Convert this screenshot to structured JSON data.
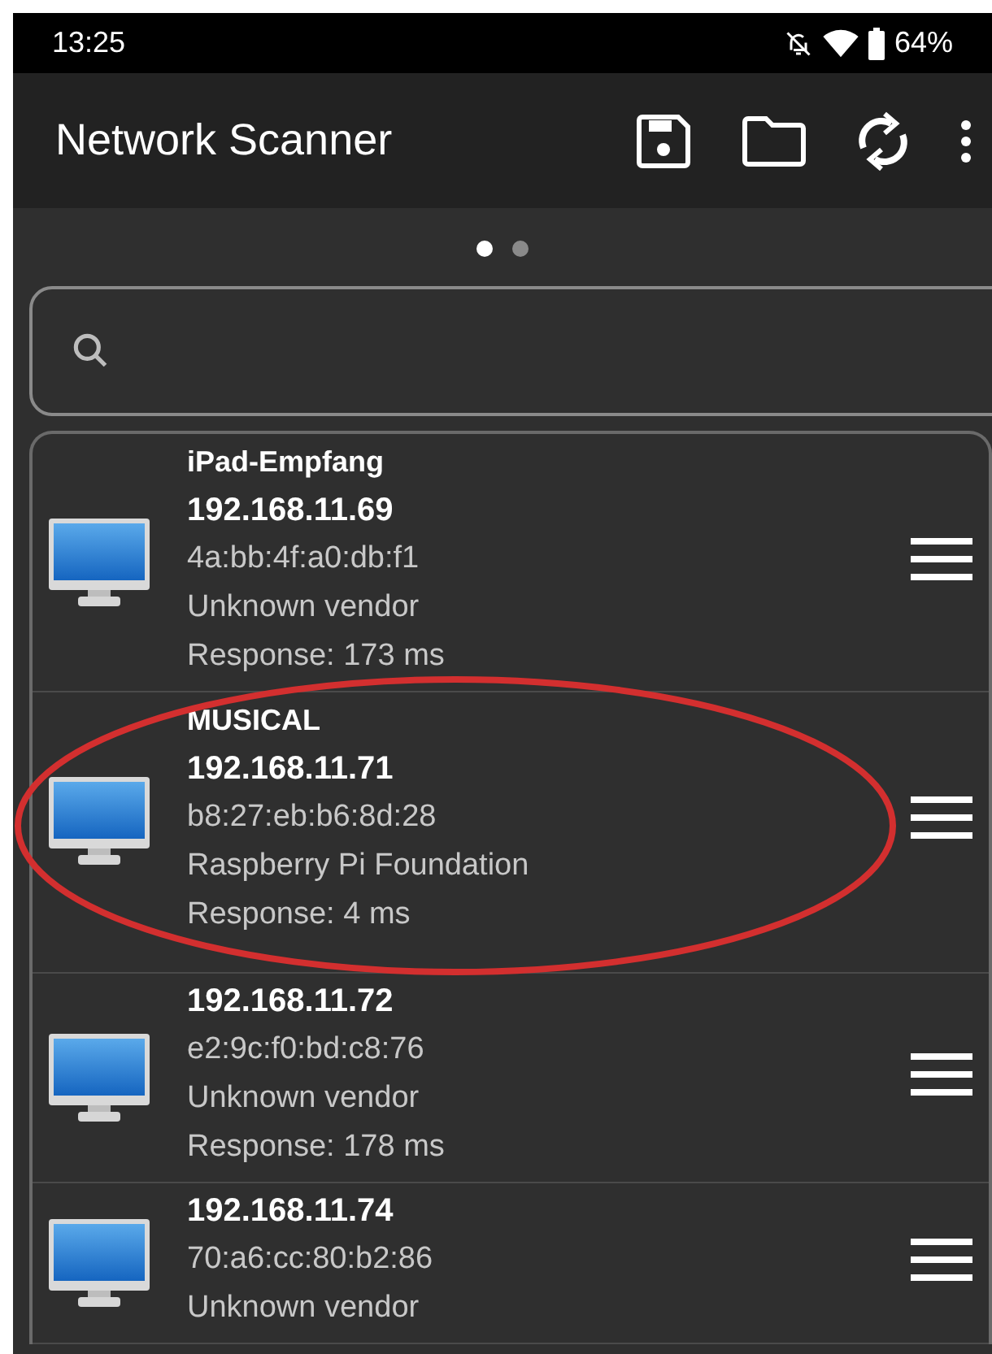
{
  "status_bar": {
    "time": "13:25",
    "battery": "64%"
  },
  "app_bar": {
    "title": "Network Scanner"
  },
  "pages": [
    {
      "selected": true
    },
    {
      "selected": false
    }
  ],
  "devices": [
    {
      "name": "iPad-Empfang",
      "ip": "192.168.11.69",
      "mac": "4a:bb:4f:a0:db:f1",
      "vendor": "Unknown vendor",
      "response": "Response: 173 ms",
      "circled": false
    },
    {
      "name": "MUSICAL",
      "ip": "192.168.11.71",
      "mac": "b8:27:eb:b6:8d:28",
      "vendor": "Raspberry Pi Foundation",
      "response": "Response: 4 ms",
      "circled": true
    },
    {
      "ip": "192.168.11.72",
      "mac": "e2:9c:f0:bd:c8:76",
      "vendor": "Unknown vendor",
      "response": "Response: 178 ms",
      "circled": false
    },
    {
      "ip": "192.168.11.74",
      "mac": "70:a6:cc:80:b2:86",
      "vendor": "Unknown vendor",
      "circled": false
    }
  ]
}
